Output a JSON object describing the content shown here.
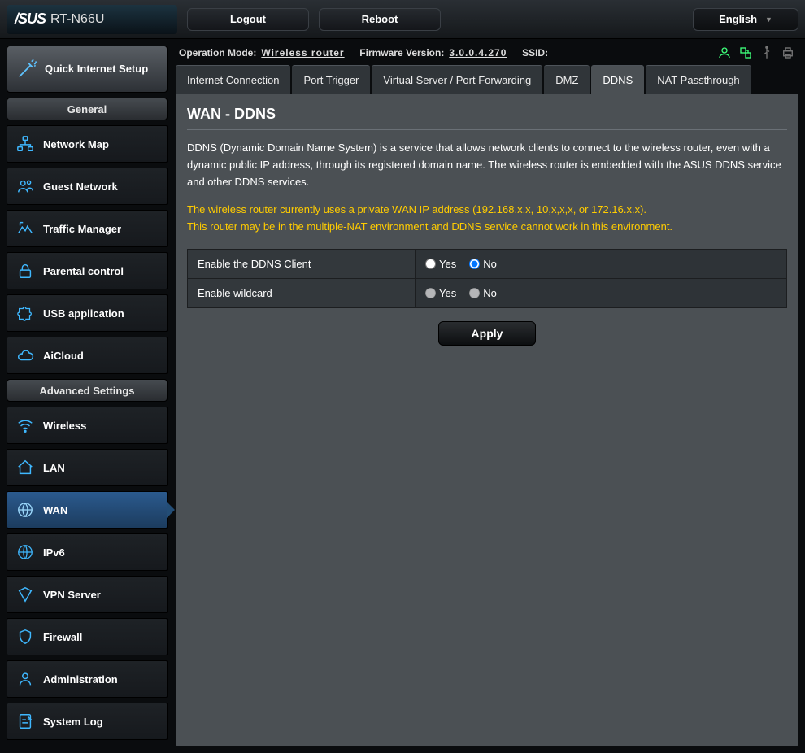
{
  "header": {
    "brand": "/SUS",
    "model": "RT-N66U",
    "logout_label": "Logout",
    "reboot_label": "Reboot",
    "language": "English"
  },
  "qis": {
    "label": "Quick Internet Setup"
  },
  "sections": {
    "general": "General",
    "advanced": "Advanced Settings"
  },
  "nav_general": [
    {
      "label": "Network Map",
      "icon": "network-map"
    },
    {
      "label": "Guest Network",
      "icon": "guest"
    },
    {
      "label": "Traffic Manager",
      "icon": "traffic"
    },
    {
      "label": "Parental control",
      "icon": "lock"
    },
    {
      "label": "USB application",
      "icon": "puzzle"
    },
    {
      "label": "AiCloud",
      "icon": "cloud"
    }
  ],
  "nav_advanced": [
    {
      "label": "Wireless",
      "icon": "wifi"
    },
    {
      "label": "LAN",
      "icon": "home"
    },
    {
      "label": "WAN",
      "icon": "globe",
      "active": true
    },
    {
      "label": "IPv6",
      "icon": "ipv6"
    },
    {
      "label": "VPN Server",
      "icon": "vpn"
    },
    {
      "label": "Firewall",
      "icon": "shield"
    },
    {
      "label": "Administration",
      "icon": "admin"
    },
    {
      "label": "System Log",
      "icon": "log"
    }
  ],
  "status": {
    "opmode_label": "Operation Mode:",
    "opmode_value": "Wireless router",
    "fw_label": "Firmware Version:",
    "fw_value": "3.0.0.4.270",
    "ssid_label": "SSID:"
  },
  "tabs": [
    {
      "label": "Internet Connection"
    },
    {
      "label": "Port Trigger"
    },
    {
      "label": "Virtual Server / Port Forwarding"
    },
    {
      "label": "DMZ"
    },
    {
      "label": "DDNS",
      "active": true
    },
    {
      "label": "NAT Passthrough"
    }
  ],
  "content": {
    "title": "WAN - DDNS",
    "description": "DDNS (Dynamic Domain Name System) is a service that allows network clients to connect to the wireless router, even with a dynamic public IP address, through its registered domain name. The wireless router is embedded with the ASUS DDNS service and other DDNS services.",
    "warning_line1": "The wireless router currently uses a private WAN IP address (192.168.x.x, 10,x,x,x, or 172.16.x.x).",
    "warning_line2": "This router may be in the multiple-NAT environment and DDNS service cannot work in this environment.",
    "row1_label": "Enable the DDNS Client",
    "row2_label": "Enable wildcard",
    "yes": "Yes",
    "no": "No",
    "apply": "Apply"
  }
}
